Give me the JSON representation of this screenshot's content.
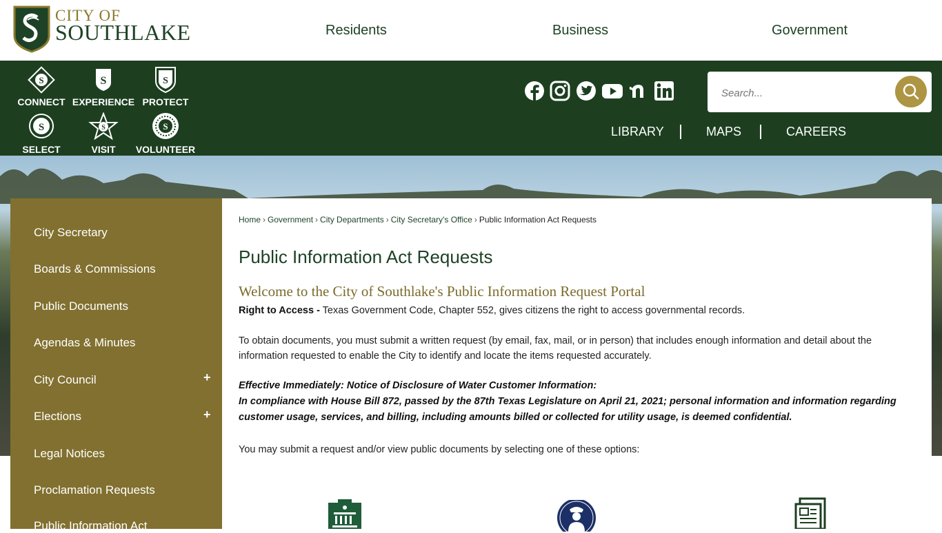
{
  "logo": {
    "line1": "CITY OF",
    "line2": "SOUTHLAKE"
  },
  "main_nav": [
    "Residents",
    "Business",
    "Government"
  ],
  "quick_links": [
    {
      "label": "CONNECT",
      "icon": "connect-icon"
    },
    {
      "label": "EXPERIENCE",
      "icon": "experience-icon"
    },
    {
      "label": "PROTECT",
      "icon": "protect-icon"
    },
    {
      "label": "SELECT",
      "icon": "select-icon"
    },
    {
      "label": "VISIT",
      "icon": "visit-icon"
    },
    {
      "label": "VOLUNTEER",
      "icon": "volunteer-icon"
    }
  ],
  "social": [
    "facebook-icon",
    "instagram-icon",
    "twitter-icon",
    "youtube-icon",
    "nextdoor-icon",
    "linkedin-icon"
  ],
  "search": {
    "placeholder": "Search..."
  },
  "utility_links": [
    "LIBRARY",
    "MAPS",
    "CAREERS"
  ],
  "sidebar": {
    "items": [
      {
        "label": "City Secretary",
        "expandable": false
      },
      {
        "label": "Boards & Commissions",
        "expandable": false
      },
      {
        "label": "Public Documents",
        "expandable": false
      },
      {
        "label": "Agendas & Minutes",
        "expandable": false
      },
      {
        "label": "City Council",
        "expandable": true
      },
      {
        "label": "Elections",
        "expandable": true
      },
      {
        "label": "Legal Notices",
        "expandable": false
      },
      {
        "label": "Proclamation Requests",
        "expandable": false
      },
      {
        "label": "Public Information Act",
        "expandable": false
      }
    ],
    "expand_symbol": "+"
  },
  "breadcrumb": [
    "Home",
    "Government",
    "City Departments",
    "City Secretary's Office",
    "Public Information Act Requests"
  ],
  "breadcrumb_separator": "›",
  "page_title": "Public Information Act Requests",
  "welcome_heading": "Welcome to the City of Southlake's Public Information Request Portal",
  "right_to_access": {
    "label": "Right to Access -",
    "text": " Texas Government Code, Chapter 552, gives citizens the right to access governmental records."
  },
  "obtain_text": "To obtain documents, you must submit a written request (by email, fax, mail, or in person) that includes enough information and detail about the information requested to enable the City to identify and locate the items requested accurately.",
  "notice": {
    "heading": "Effective Immediately: Notice of Disclosure of Water Customer Information:",
    "body": "In compliance with House Bill 872, passed by the 87th Texas Legislature on April 21, 2021; personal information and information regarding customer usage, services, and billing, including amounts billed or collected for utility usage, is deemed confidential."
  },
  "options_text": "You may submit a request and/or view public documents by selecting one of these options:",
  "option_icons": [
    "city-hall-icon",
    "police-badge-icon",
    "documents-icon"
  ],
  "colors": {
    "green": "#1d3f20",
    "gold": "#81702f",
    "search_button": "#ad9543"
  }
}
